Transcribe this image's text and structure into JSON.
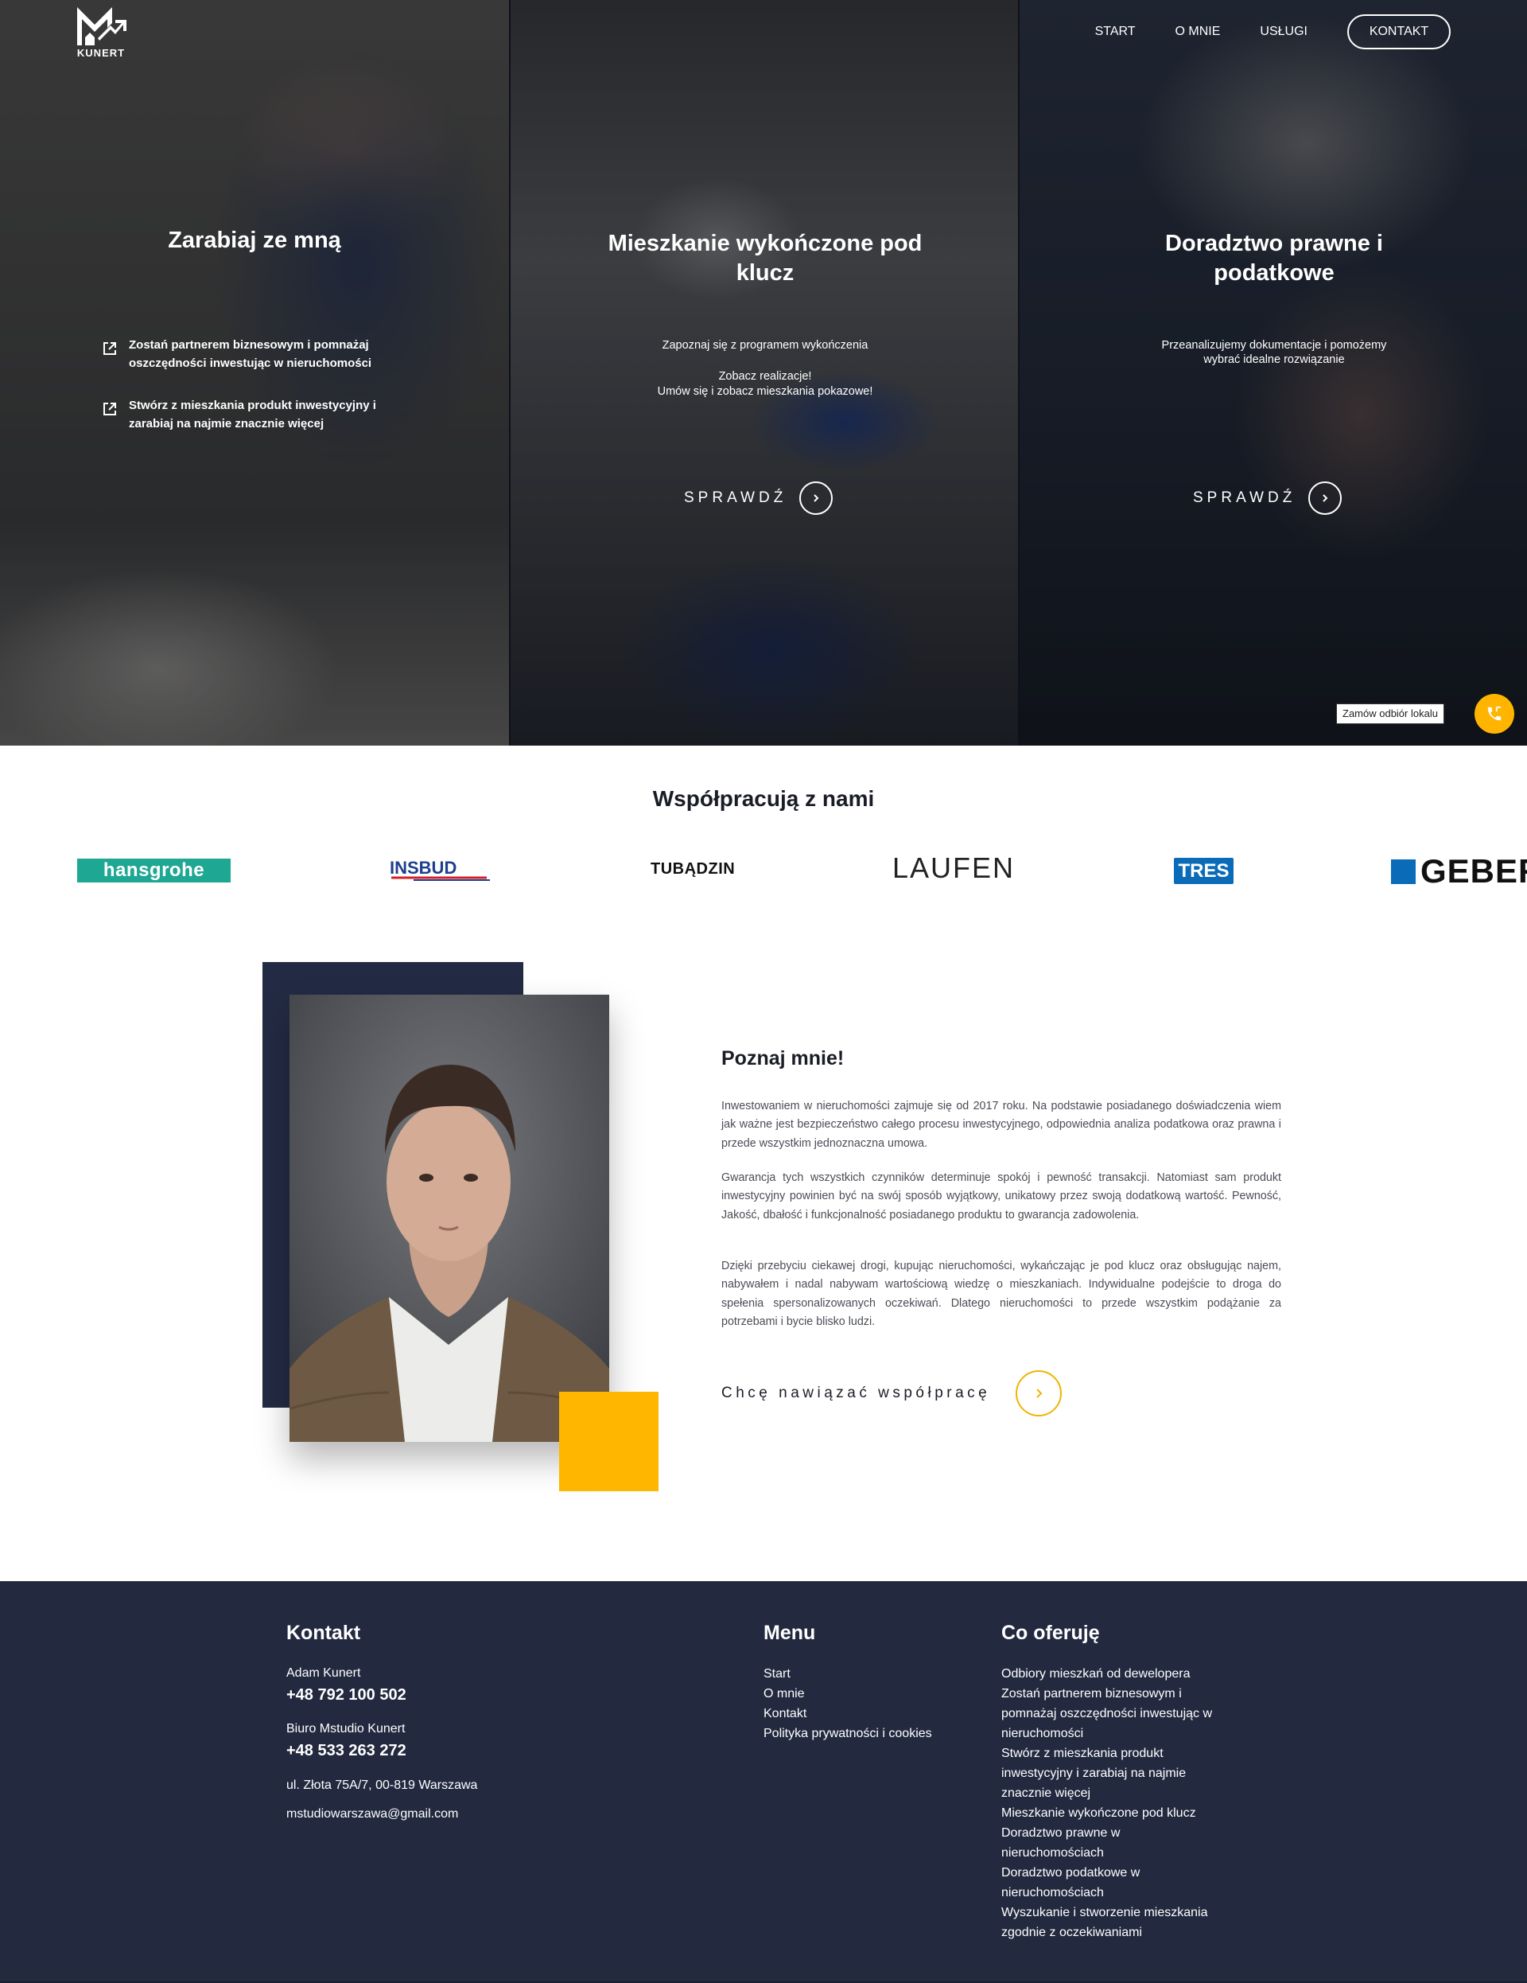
{
  "brand": {
    "logo_text": "KUNERT"
  },
  "nav": {
    "items": [
      "START",
      "O MNIE",
      "USŁUGI"
    ],
    "contact_label": "KONTAKT"
  },
  "hero": {
    "panels": [
      {
        "title": "Zarabiaj ze mną",
        "bullets": [
          "Zostań partnerem biznesowym i pomnażaj oszczędności inwestując w nieruchomości",
          "Stwórz z mieszkania produkt inwestycyjny i zarabiaj na najmie znacznie więcej"
        ]
      },
      {
        "title": "Mieszkanie wykończone pod klucz",
        "desc_line1": "Zapoznaj się z programem wykończenia",
        "desc_line2": "Zobacz realizacje!",
        "desc_line3": "Umów się i zobacz mieszkania pokazowe!",
        "cta": "SPRAWDŹ"
      },
      {
        "title": "Doradztwo prawne i podatkowe",
        "desc_line1": "Przeanalizujemy dokumentacje i pomożemy",
        "desc_line2": "wybrać idealne rozwiązanie",
        "cta": "SPRAWDŹ"
      }
    ]
  },
  "call_widget": {
    "label": "Zamów odbiór lokalu"
  },
  "partners": {
    "title": "Współpracują z nami",
    "logos": [
      "hansgrohe",
      "INSBUD",
      "TUBĄDZIN",
      "LAUFEN",
      "TRES",
      "GEBER"
    ]
  },
  "about": {
    "title": "Poznaj mnie!",
    "paragraphs": [
      "Inwestowaniem w nieruchomości zajmuje się od 2017 roku. Na podstawie posiadanego doświadczenia wiem jak ważne jest bezpieczeństwo całego procesu inwestycyjnego, odpowiednia analiza podatkowa oraz prawna i przede wszystkim jednoznaczna umowa.",
      "Gwarancja tych wszystkich czynników determinuje spokój i pewność transakcji. Natomiast sam produkt inwestycyjny powinien być na swój sposób wyjątkowy, unikatowy przez swoją dodatkową wartość. Pewność, Jakość, dbałość i funkcjonalność posiadanego produktu to gwarancja zadowolenia.",
      "Dzięki przebyciu ciekawej drogi, kupując nieruchomości, wykańczając je pod klucz oraz obsługując najem, nabywałem i nadal nabywam wartościową wiedzę o mieszkaniach. Indywidualne podejście to droga do spełenia spersonalizowanych oczekiwań. Dlatego nieruchomości to przede wszystkim podążanie za potrzebami i bycie blisko ludzi."
    ],
    "cta": "Chcę nawiązać współpracę"
  },
  "footer": {
    "contact": {
      "title": "Kontakt",
      "name1": "Adam Kunert",
      "phone1": "+48 792 100 502",
      "name2": "Biuro Mstudio Kunert",
      "phone2": "+48 533 263 272",
      "address": "ul. Złota 75A/7, 00-819 Warszawa",
      "email": "mstudiowarszawa@gmail.com"
    },
    "menu": {
      "title": "Menu",
      "items": [
        "Start",
        "O mnie",
        "Kontakt",
        "Polityka prywatności i cookies"
      ]
    },
    "offer": {
      "title": "Co oferuję",
      "lines": [
        "Odbiory mieszkań od dewelopera",
        "Zostań partnerem biznesowym i",
        "pomnażaj oszczędności inwestując w",
        "nieruchomości",
        "Stwórz z mieszkania produkt",
        "inwestycyjny i zarabiaj na najmie",
        "znacznie więcej",
        "Mieszkanie wykończone pod klucz",
        "Doradztwo prawne w",
        "nieruchomościach",
        "Doradztwo podatkowe w",
        "nieruchomościach",
        "Wyszukanie i stworzenie mieszkania",
        "zgodnie z oczekiwaniami"
      ]
    }
  },
  "colors": {
    "accent": "#ffb600",
    "navy": "#232a40",
    "hansgrohe": "#1ea793",
    "tres": "#0a6bb8"
  },
  "icons": [
    "external-link-icon",
    "chevron-right-icon",
    "phone-icon"
  ]
}
